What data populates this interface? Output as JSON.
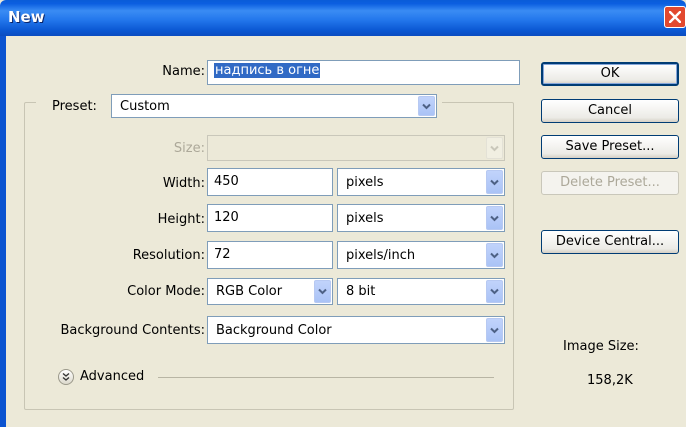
{
  "window": {
    "title": "New"
  },
  "form": {
    "name": {
      "label": "Name:",
      "value": "надпись в огне"
    },
    "preset": {
      "label": "Preset:",
      "value": "Custom"
    },
    "size": {
      "label": "Size:",
      "value": ""
    },
    "width": {
      "label": "Width:",
      "value": "450",
      "unit": "pixels"
    },
    "height": {
      "label": "Height:",
      "value": "120",
      "unit": "pixels"
    },
    "resolution": {
      "label": "Resolution:",
      "value": "72",
      "unit": "pixels/inch"
    },
    "color_mode": {
      "label": "Color Mode:",
      "value": "RGB Color",
      "depth": "8 bit"
    },
    "background": {
      "label": "Background Contents:",
      "value": "Background Color"
    },
    "advanced": {
      "label": "Advanced"
    }
  },
  "buttons": {
    "ok": "OK",
    "cancel": "Cancel",
    "save_preset": "Save Preset...",
    "delete_preset": "Delete Preset...",
    "device_central": "Device Central..."
  },
  "image_size": {
    "label": "Image Size:",
    "value": "158,2K"
  },
  "colors": {
    "titlebar": "#0a5cd8",
    "dialog_bg": "#ece9d8",
    "selection": "#316ac5",
    "close": "#e2492f"
  }
}
